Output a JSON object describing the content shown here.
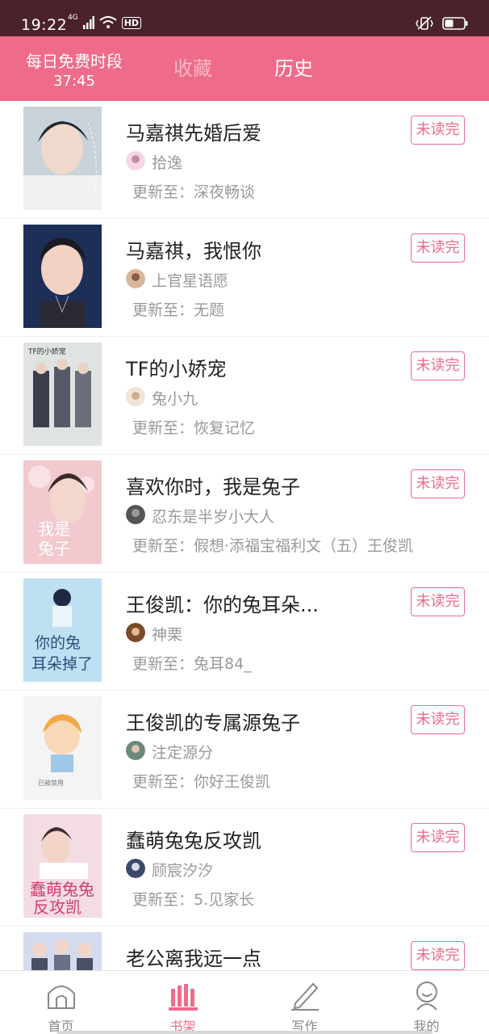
{
  "status_bar": {
    "time": "19:22",
    "network": "4G",
    "hd": "HD"
  },
  "header": {
    "free_title": "每日免费时段",
    "free_countdown": "37:45",
    "tabs": [
      {
        "label": "收藏"
      },
      {
        "label": "历史"
      }
    ],
    "active_tab": "历史",
    "accent_color": "#ee6b8a"
  },
  "books": [
    {
      "title": "马嘉祺先婚后爱",
      "author": "拾逸",
      "update_prefix": "更新至：",
      "update": "深夜畅谈",
      "badge": "未读完"
    },
    {
      "title": "马嘉祺，我恨你",
      "author": "上官星语愿",
      "update_prefix": "更新至：",
      "update": "无题",
      "badge": "未读完"
    },
    {
      "title": "TF的小娇宠",
      "author": "兔小九",
      "update_prefix": "更新至：",
      "update": "恢复记忆",
      "badge": "未读完"
    },
    {
      "title": "喜欢你时，我是兔子",
      "author": "忍东是半岁小大人",
      "update_prefix": "更新至：",
      "update": "假想·添福宝福利文（五）王俊凯",
      "badge": "未读完"
    },
    {
      "title": "王俊凯：你的兔耳朵...",
      "author": "神栗",
      "update_prefix": "更新至：",
      "update": "兔耳84_",
      "badge": "未读完"
    },
    {
      "title": "王俊凯的专属源兔子",
      "author": "注定源分",
      "update_prefix": "更新至：",
      "update": "你好王俊凯",
      "badge": "未读完"
    },
    {
      "title": "蠢萌兔兔反攻凯",
      "author": "顾宸汐汐",
      "update_prefix": "更新至：",
      "update": "5.见家长",
      "badge": "未读完"
    },
    {
      "title": "老公离我远一点",
      "author": "",
      "update_prefix": "",
      "update": "",
      "badge": "未读完"
    }
  ],
  "bottom_nav": [
    {
      "label": "首页",
      "icon": "home-icon"
    },
    {
      "label": "书架",
      "icon": "bookshelf-icon"
    },
    {
      "label": "写作",
      "icon": "pencil-icon"
    },
    {
      "label": "我的",
      "icon": "profile-icon"
    }
  ]
}
